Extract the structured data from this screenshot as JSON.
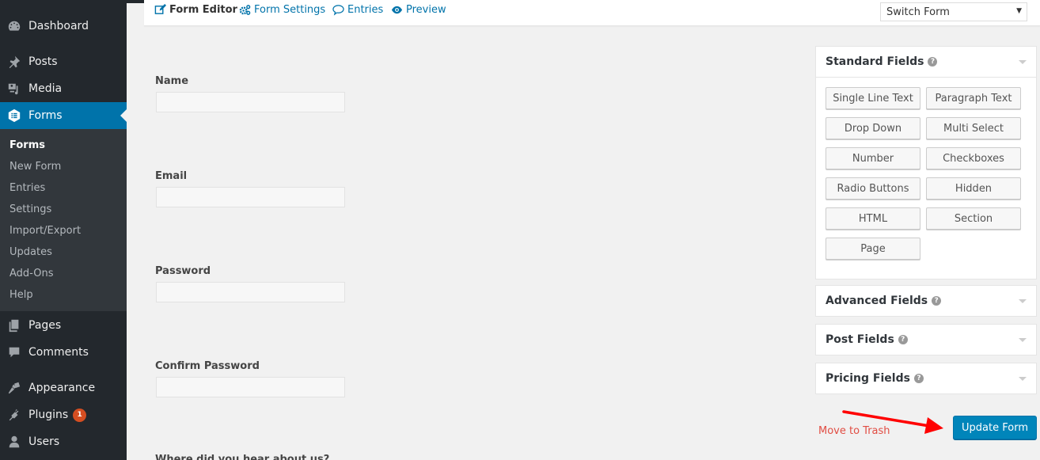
{
  "sidebar": {
    "items": [
      {
        "label": "Dashboard",
        "icon": "dashboard-icon"
      },
      {
        "label": "Posts",
        "icon": "pin-icon"
      },
      {
        "label": "Media",
        "icon": "media-icon"
      },
      {
        "label": "Forms",
        "icon": "forms-icon",
        "active": true
      },
      {
        "label": "Pages",
        "icon": "pages-icon"
      },
      {
        "label": "Comments",
        "icon": "comment-icon"
      },
      {
        "label": "Appearance",
        "icon": "paintbrush-icon"
      },
      {
        "label": "Plugins",
        "icon": "plugin-icon",
        "badge": "1"
      },
      {
        "label": "Users",
        "icon": "user-icon"
      }
    ],
    "submenu": [
      "Forms",
      "New Form",
      "Entries",
      "Settings",
      "Import/Export",
      "Updates",
      "Add-Ons",
      "Help"
    ]
  },
  "toolbar": {
    "form_editor": "Form Editor",
    "form_settings": "Form Settings",
    "entries": "Entries",
    "preview": "Preview",
    "switch_form": "Switch Form"
  },
  "form": {
    "fields": [
      {
        "label": "Name",
        "value": ""
      },
      {
        "label": "Email",
        "value": ""
      },
      {
        "label": "Password",
        "value": ""
      },
      {
        "label": "Confirm Password",
        "value": ""
      }
    ],
    "partial_label": "Where did you hear about us?"
  },
  "panels": {
    "standard": {
      "title": "Standard Fields",
      "buttons": [
        "Single Line Text",
        "Paragraph Text",
        "Drop Down",
        "Multi Select",
        "Number",
        "Checkboxes",
        "Radio Buttons",
        "Hidden",
        "HTML",
        "Section",
        "Page"
      ]
    },
    "advanced": {
      "title": "Advanced Fields"
    },
    "post": {
      "title": "Post Fields"
    },
    "pricing": {
      "title": "Pricing Fields"
    },
    "help_glyph": "?"
  },
  "actions": {
    "trash": "Move to Trash",
    "update": "Update Form"
  },
  "colors": {
    "accent": "#0073aa",
    "sidebar_bg": "#23282d",
    "submenu_bg": "#32373c",
    "badge": "#d54e21",
    "trash": "#e14d43",
    "annotation_arrow": "#ff0000"
  }
}
